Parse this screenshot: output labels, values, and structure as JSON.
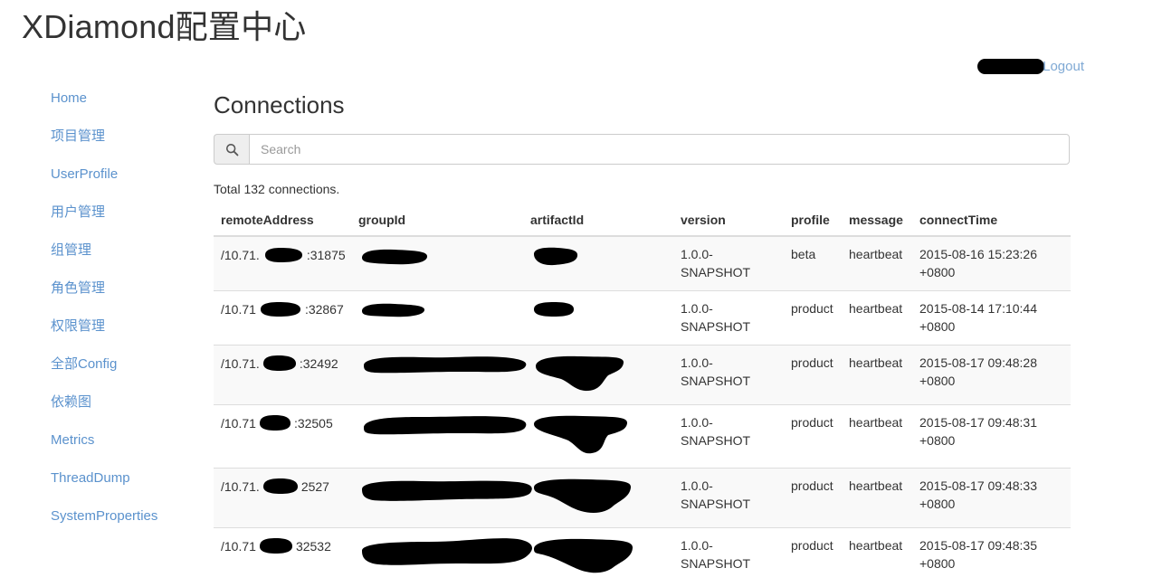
{
  "app": {
    "title": "XDiamond配置中心"
  },
  "account": {
    "username_redacted": "",
    "logout_label": "Logout"
  },
  "sidebar": {
    "items": [
      {
        "label": "Home"
      },
      {
        "label": "项目管理"
      },
      {
        "label": "UserProfile"
      },
      {
        "label": "用户管理"
      },
      {
        "label": "组管理"
      },
      {
        "label": "角色管理"
      },
      {
        "label": "权限管理"
      },
      {
        "label": "全部Config"
      },
      {
        "label": "依赖图"
      },
      {
        "label": "Metrics"
      },
      {
        "label": "ThreadDump"
      },
      {
        "label": "SystemProperties"
      }
    ]
  },
  "main": {
    "heading": "Connections",
    "search": {
      "placeholder": "Search",
      "value": "",
      "icon": "search-icon"
    },
    "total_text": "Total 132 connections.",
    "table": {
      "columns": [
        "remoteAddress",
        "groupId",
        "artifactId",
        "version",
        "profile",
        "message",
        "connectTime"
      ],
      "rows": [
        {
          "remoteAddress_prefix": "/10.71.",
          "remoteAddress_port": ":31875",
          "groupId": "",
          "artifactId": "",
          "version": "1.0.0-SNAPSHOT",
          "profile": "beta",
          "message": "heartbeat",
          "connectTime": "2015-08-16 15:23:26 +0800"
        },
        {
          "remoteAddress_prefix": "/10.71",
          "remoteAddress_port": ":32867",
          "groupId": "",
          "artifactId": "",
          "version": "1.0.0-SNAPSHOT",
          "profile": "product",
          "message": "heartbeat",
          "connectTime": "2015-08-14 17:10:44 +0800"
        },
        {
          "remoteAddress_prefix": "/10.71.",
          "remoteAddress_port": ":32492",
          "groupId": "",
          "artifactId": "",
          "version": "1.0.0-SNAPSHOT",
          "profile": "product",
          "message": "heartbeat",
          "connectTime": "2015-08-17 09:48:28 +0800"
        },
        {
          "remoteAddress_prefix": "/10.71",
          "remoteAddress_port": ":32505",
          "groupId": "",
          "artifactId": "",
          "version": "1.0.0-SNAPSHOT",
          "profile": "product",
          "message": "heartbeat",
          "connectTime": "2015-08-17 09:48:31 +0800"
        },
        {
          "remoteAddress_prefix": "/10.71.",
          "remoteAddress_port": "2527",
          "groupId": "",
          "artifactId": "",
          "version": "1.0.0-SNAPSHOT",
          "profile": "product",
          "message": "heartbeat",
          "connectTime": "2015-08-17 09:48:33 +0800"
        },
        {
          "remoteAddress_prefix": "/10.71",
          "remoteAddress_port": "32532",
          "groupId": "",
          "artifactId": "",
          "version": "1.0.0-SNAPSHOT",
          "profile": "product",
          "message": "heartbeat",
          "connectTime": "2015-08-17 09:48:35 +0800"
        }
      ]
    }
  },
  "colors": {
    "link": "#5b92cd",
    "text": "#333333",
    "row_stripe": "#f9f9f9",
    "border": "#dddddd",
    "redaction": "#000000"
  }
}
